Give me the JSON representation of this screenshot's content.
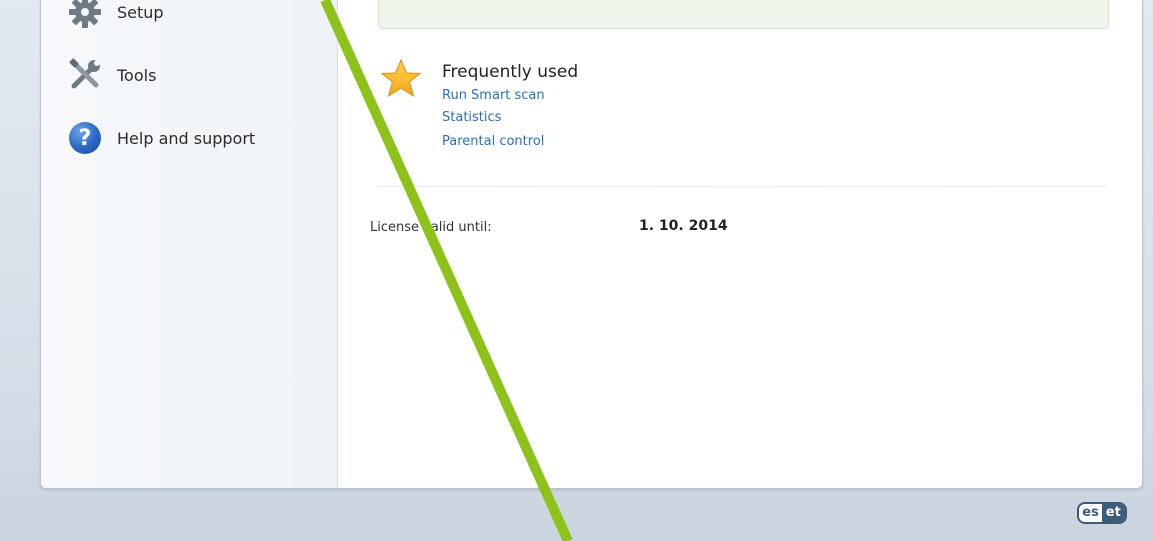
{
  "sidebar": {
    "items": [
      {
        "label": "Setup",
        "icon": "gear-icon"
      },
      {
        "label": "Tools",
        "icon": "tools-icon"
      },
      {
        "label": "Help and support",
        "icon": "help-icon"
      }
    ]
  },
  "main": {
    "frequently_used": {
      "title": "Frequently used",
      "icon": "star-icon",
      "links": [
        "Run Smart scan",
        "Statistics",
        "Parental control"
      ]
    },
    "license": {
      "label": "License valid until:",
      "value": "1. 10. 2014"
    }
  },
  "footer": {
    "logo_part1": "es",
    "logo_part2": "et"
  },
  "colors": {
    "annotation_line": "#8cc21a",
    "link": "#2a6fb8",
    "status_panel": "#eef6ec"
  }
}
